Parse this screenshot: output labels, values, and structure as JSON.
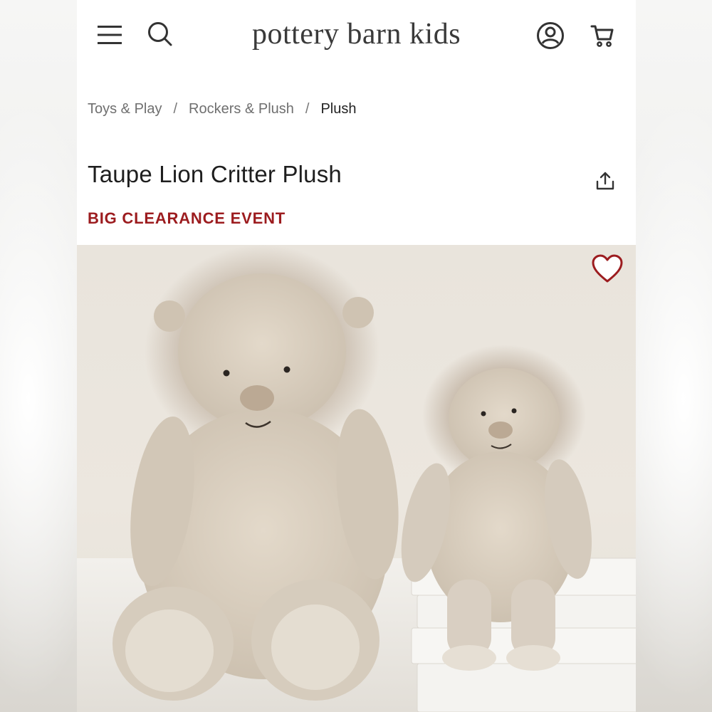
{
  "header": {
    "logo": "pottery barn kids",
    "icons": {
      "menu": "hamburger-menu-icon",
      "search": "search-icon",
      "account": "user-account-icon",
      "cart": "shopping-cart-icon"
    }
  },
  "breadcrumb": {
    "items": [
      "Toys & Play",
      "Rockers & Plush",
      "Plush"
    ],
    "separator": "/"
  },
  "product": {
    "title": "Taupe Lion Critter Plush",
    "promo": "BIG CLEARANCE EVENT",
    "promo_color": "#9c1c1f"
  },
  "colors": {
    "favorite_heart": "#9c1c1f"
  }
}
